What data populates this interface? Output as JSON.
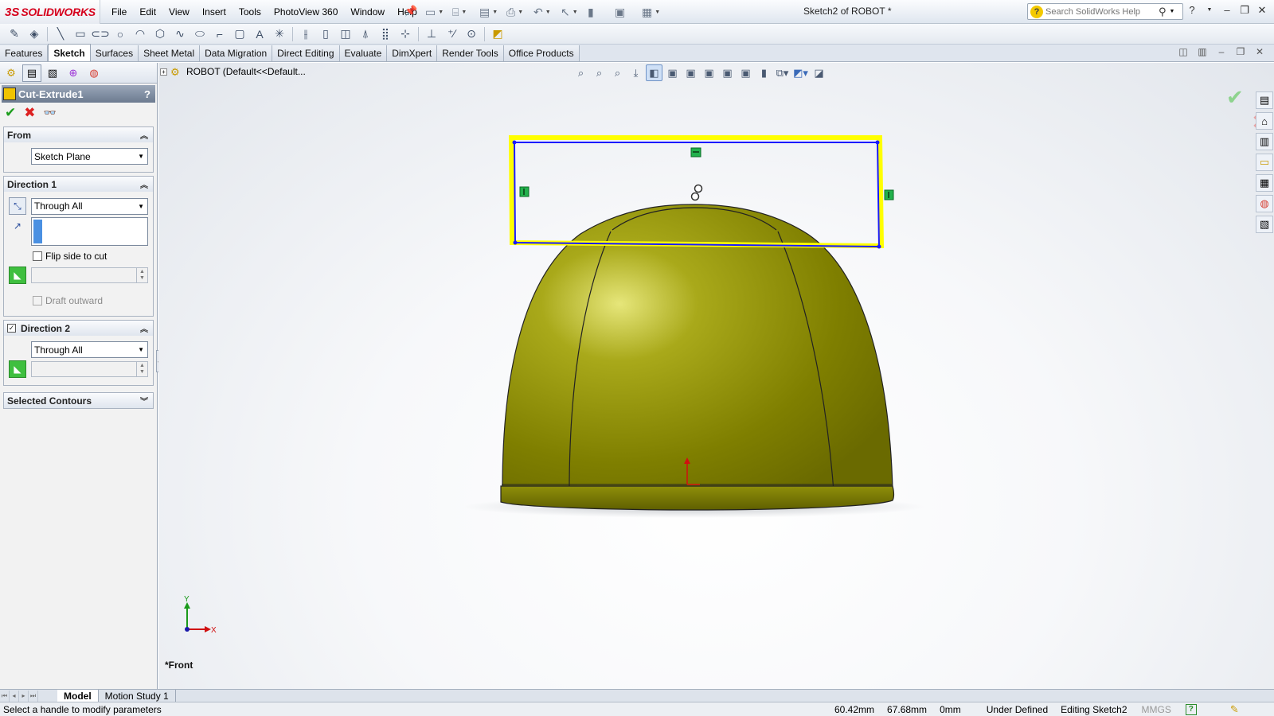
{
  "app": {
    "brand_ds": "3S",
    "brand": "SOLIDWORKS",
    "doc_title": "Sketch2 of ROBOT *"
  },
  "menu": [
    "File",
    "Edit",
    "View",
    "Insert",
    "Tools",
    "PhotoView 360",
    "Window",
    "Help"
  ],
  "search": {
    "placeholder": "Search SolidWorks Help"
  },
  "command_tabs": [
    "Features",
    "Sketch",
    "Surfaces",
    "Sheet Metal",
    "Data Migration",
    "Direct Editing",
    "Evaluate",
    "DimXpert",
    "Render Tools",
    "Office Products"
  ],
  "active_command_tab": "Sketch",
  "property_manager": {
    "title": "Cut-Extrude1",
    "help": "?",
    "from": {
      "label": "From",
      "value": "Sketch Plane"
    },
    "direction1": {
      "label": "Direction 1",
      "end_condition": "Through All",
      "flip_side_label": "Flip side to cut",
      "draft_outward_label": "Draft outward"
    },
    "direction2": {
      "label": "Direction 2",
      "checked": true,
      "end_condition": "Through All"
    },
    "selected_contours": {
      "label": "Selected Contours"
    }
  },
  "graphics": {
    "tree_root": "ROBOT  (Default<<Default...",
    "view_name": "*Front",
    "axis_y": "Y",
    "axis_x": "X",
    "model_color": "#a8a800",
    "sketch_highlight_color": "#ffff00",
    "sketch_line_color": "#1a1aff"
  },
  "bottom_tabs": [
    "Model",
    "Motion Study 1"
  ],
  "active_bottom_tab": "Model",
  "status": {
    "message": "Select a handle to modify parameters",
    "x": "60.42mm",
    "y": "67.68mm",
    "z": "0mm",
    "state": "Under Defined",
    "editing": "Editing Sketch2",
    "units": "MMGS"
  },
  "icons": {
    "ok": "✔",
    "cancel": "✖",
    "help": "?"
  }
}
